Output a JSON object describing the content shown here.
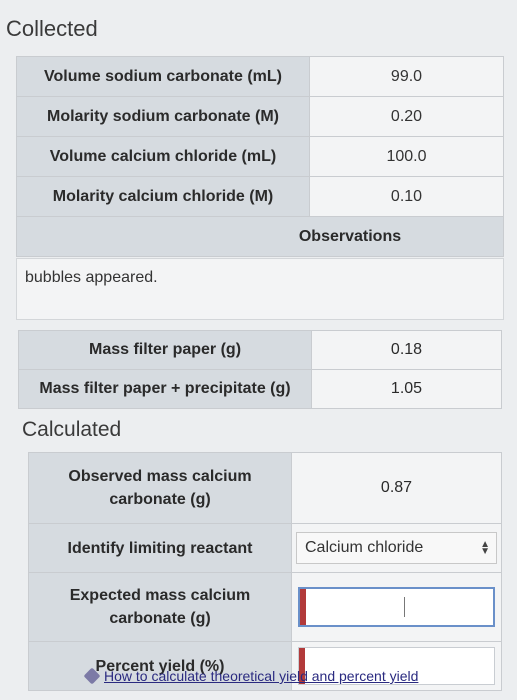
{
  "collected": {
    "title": "Collected",
    "rows": [
      {
        "label": "Volume sodium carbonate (mL)",
        "value": "99.0"
      },
      {
        "label": "Molarity sodium carbonate (M)",
        "value": "0.20"
      },
      {
        "label": "Volume calcium chloride (mL)",
        "value": "100.0"
      },
      {
        "label": "Molarity calcium chloride (M)",
        "value": "0.10"
      }
    ],
    "observations_header": "Observations",
    "observations_text": "bubbles appeared.",
    "mass_rows": [
      {
        "label": "Mass filter paper (g)",
        "value": "0.18"
      },
      {
        "label": "Mass filter paper + precipitate (g)",
        "value": "1.05"
      }
    ]
  },
  "calculated": {
    "title": "Calculated",
    "observed_mass": {
      "label_line1": "Observed mass calcium",
      "label_line2": "carbonate (g)",
      "value": "0.87"
    },
    "limiting": {
      "label": "Identify limiting reactant",
      "selected": "Calcium chloride"
    },
    "expected_mass": {
      "label_line1": "Expected mass calcium",
      "label_line2": "carbonate (g)",
      "value": ""
    },
    "percent_yield": {
      "label": "Percent yield (%)",
      "value": ""
    }
  },
  "help": {
    "link_text": "How to calculate theoretical yield and percent yield",
    "icon": "diamond-icon"
  }
}
